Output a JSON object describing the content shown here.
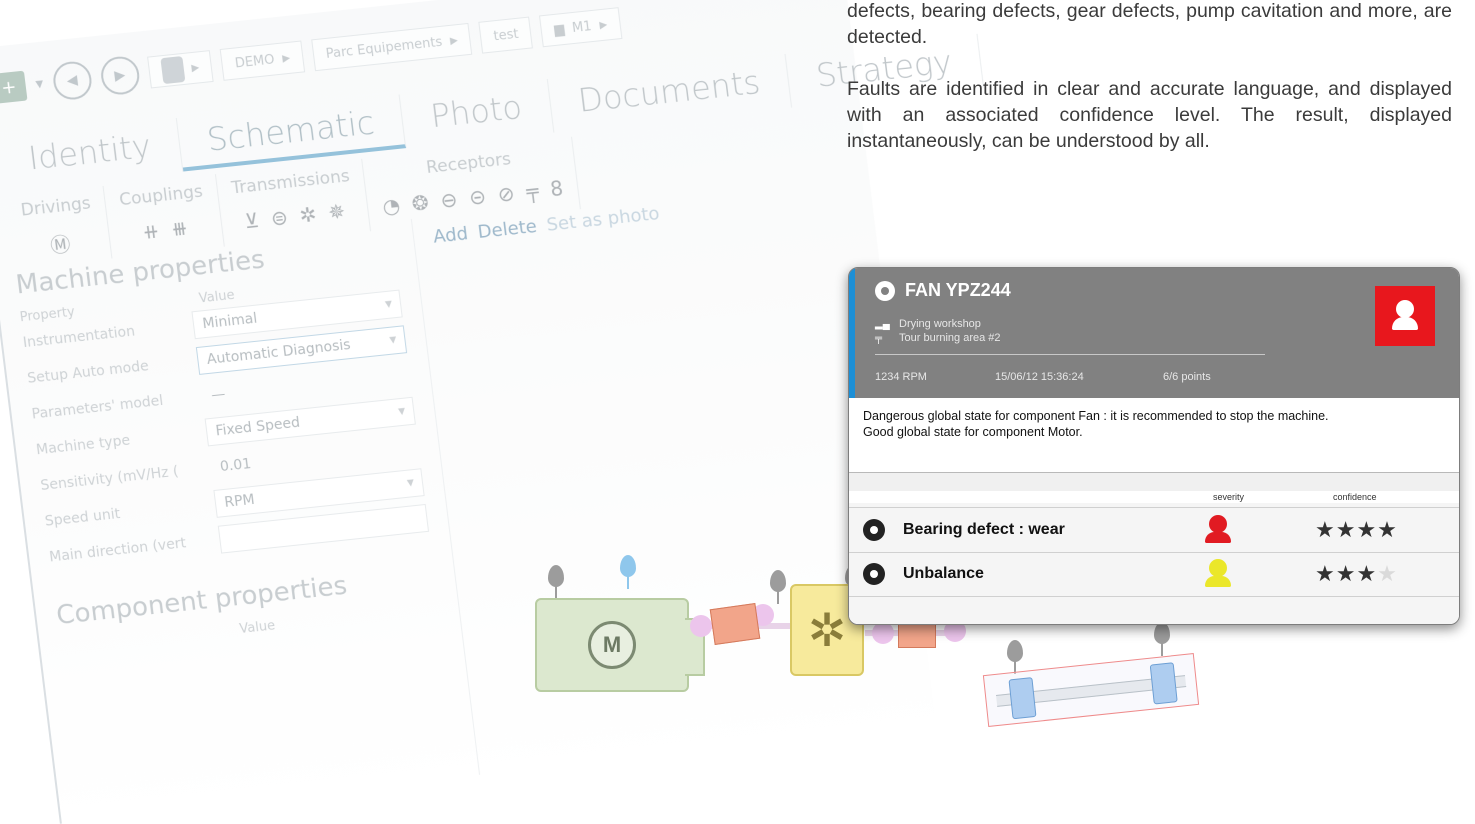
{
  "paragraphs": {
    "p1": "defects, bearing defects, gear defects, pump cavitation and more, are detected.",
    "p2": "Faults are identified in clear and accurate language, and displayed with an associated confidence level. The result, displayed instantaneously, can be understood by all."
  },
  "software": {
    "breadcrumbs": [
      "DEMO",
      "Parc Equipements",
      "test",
      "M1"
    ],
    "tabs": [
      "Identity",
      "Schematic",
      "Photo",
      "Documents",
      "Strategy"
    ],
    "active_tab": "Schematic",
    "groups": [
      "Drivings",
      "Couplings",
      "Transmissions",
      "Receptors"
    ],
    "actions": [
      "Add",
      "Delete",
      "Set as photo"
    ],
    "machine_properties": {
      "title": "Machine properties",
      "col_property": "Property",
      "col_value": "Value",
      "rows": [
        {
          "label": "Instrumentation",
          "value": "Minimal"
        },
        {
          "label": "Setup Auto mode",
          "value": "Automatic Diagnosis"
        },
        {
          "label": "Parameters' model",
          "value": "—"
        },
        {
          "label": "Machine type",
          "value": "Fixed Speed"
        },
        {
          "label": "Sensitivity (mV/Hz (",
          "value": "0.01"
        },
        {
          "label": "Speed unit",
          "value": "RPM"
        },
        {
          "label": "Main direction (vert",
          "value": ""
        }
      ]
    },
    "component_properties": {
      "title": "Component properties",
      "col_value": "Value"
    }
  },
  "diagram": {
    "motor_label": "M"
  },
  "card": {
    "title": "FAN YPZ244",
    "location": "Drying workshop",
    "area": "Tour burning area #2",
    "rpm": "1234 RPM",
    "datetime": "15/06/12 15:36:24",
    "points": "6/6 points",
    "message_line1": "Dangerous global state for component Fan : it is recommended to stop the machine.",
    "message_line2": "Good global state for component Motor.",
    "col_severity": "severity",
    "col_confidence": "confidence",
    "faults": [
      {
        "label": "Bearing defect : wear",
        "severity": "red",
        "confidence": 4
      },
      {
        "label": "Unbalance",
        "severity": "yellow",
        "confidence": 3
      }
    ],
    "colors": {
      "header": "#818181",
      "accent": "#1c8fd6",
      "danger": "#e8171d",
      "warning": "#ebe72a"
    }
  }
}
